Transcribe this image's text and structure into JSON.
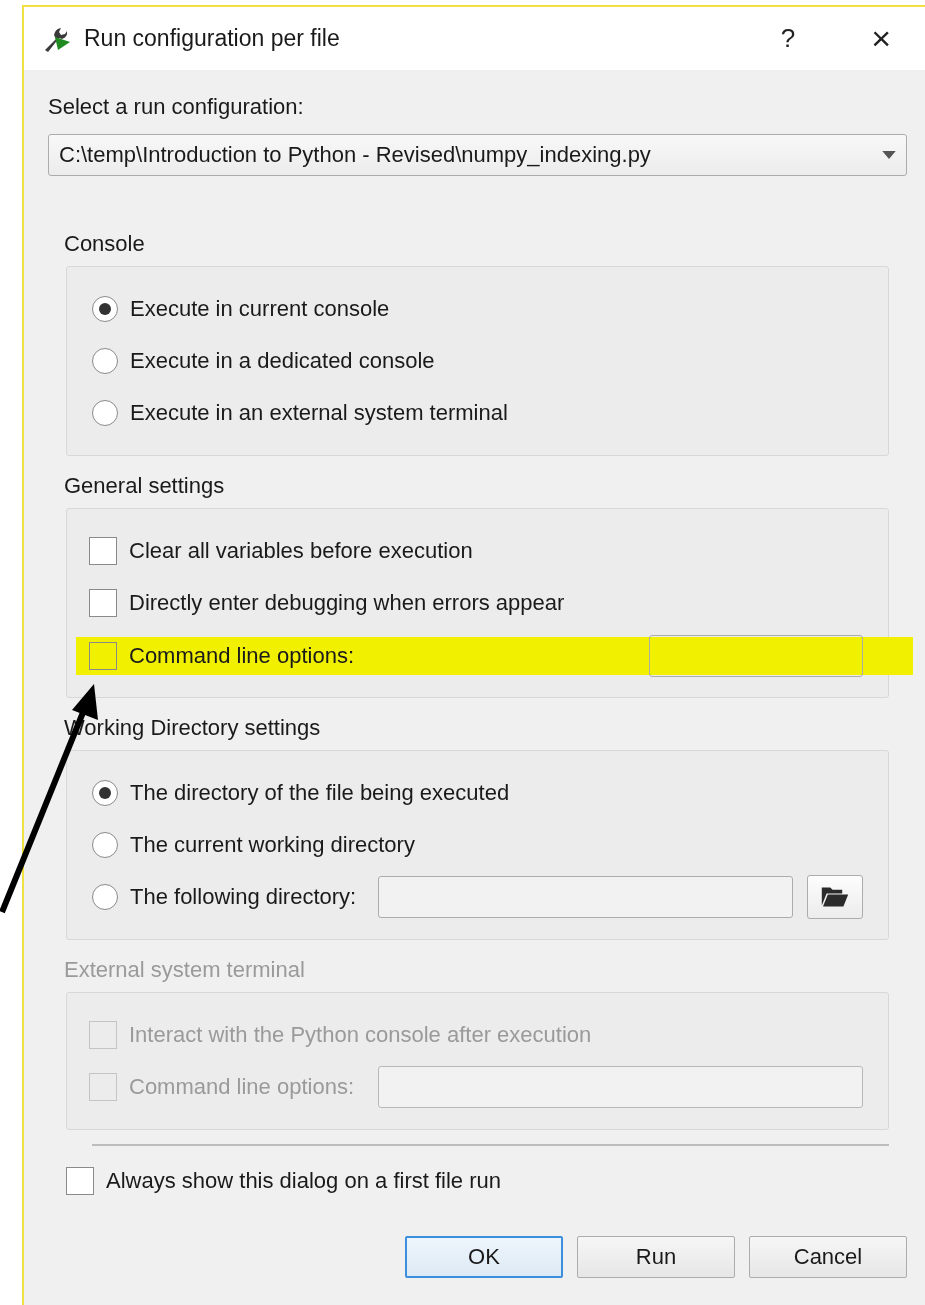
{
  "window": {
    "title": "Run configuration per file",
    "help": "?",
    "close": "×"
  },
  "run_configuration": {
    "label": "Select a run configuration:",
    "value": "C:\\temp\\Introduction to Python - Revised\\numpy_indexing.py"
  },
  "groups": [
    {
      "title": "Console",
      "disabled": false,
      "items": [
        {
          "kind": "radio",
          "label": "Execute in current console",
          "selected": true
        },
        {
          "kind": "radio",
          "label": "Execute in a dedicated console",
          "selected": false
        },
        {
          "kind": "radio",
          "label": "Execute in an external system terminal",
          "selected": false
        }
      ]
    },
    {
      "title": "General settings",
      "disabled": false,
      "items": [
        {
          "kind": "checkbox",
          "label": "Clear all variables before execution",
          "checked": false,
          "highlighted": false
        },
        {
          "kind": "checkbox",
          "label": "Directly enter debugging when errors appear",
          "checked": false,
          "highlighted": false
        },
        {
          "kind": "checkbox_field",
          "label": "Command line options:",
          "checked": false,
          "highlighted": true
        }
      ]
    },
    {
      "title": "Working Directory settings",
      "disabled": false,
      "items": [
        {
          "kind": "radio",
          "label": "The directory of the file being executed",
          "selected": true
        },
        {
          "kind": "radio",
          "label": "The current working directory",
          "selected": false
        },
        {
          "kind": "radio_browse",
          "label": "The following directory:",
          "selected": false
        }
      ]
    },
    {
      "title": "External system terminal",
      "disabled": true,
      "items": [
        {
          "kind": "checkbox",
          "label": "Interact with the Python console after execution",
          "checked": false,
          "highlighted": false
        },
        {
          "kind": "checkbox_field",
          "label": "Command line options:",
          "checked": false,
          "highlighted": false
        }
      ]
    }
  ],
  "always_show": {
    "label": "Always show this dialog on a first file run",
    "checked": false
  },
  "buttons": [
    {
      "label": "OK",
      "default": true
    },
    {
      "label": "Run",
      "default": false
    },
    {
      "label": "Cancel",
      "default": false
    }
  ]
}
